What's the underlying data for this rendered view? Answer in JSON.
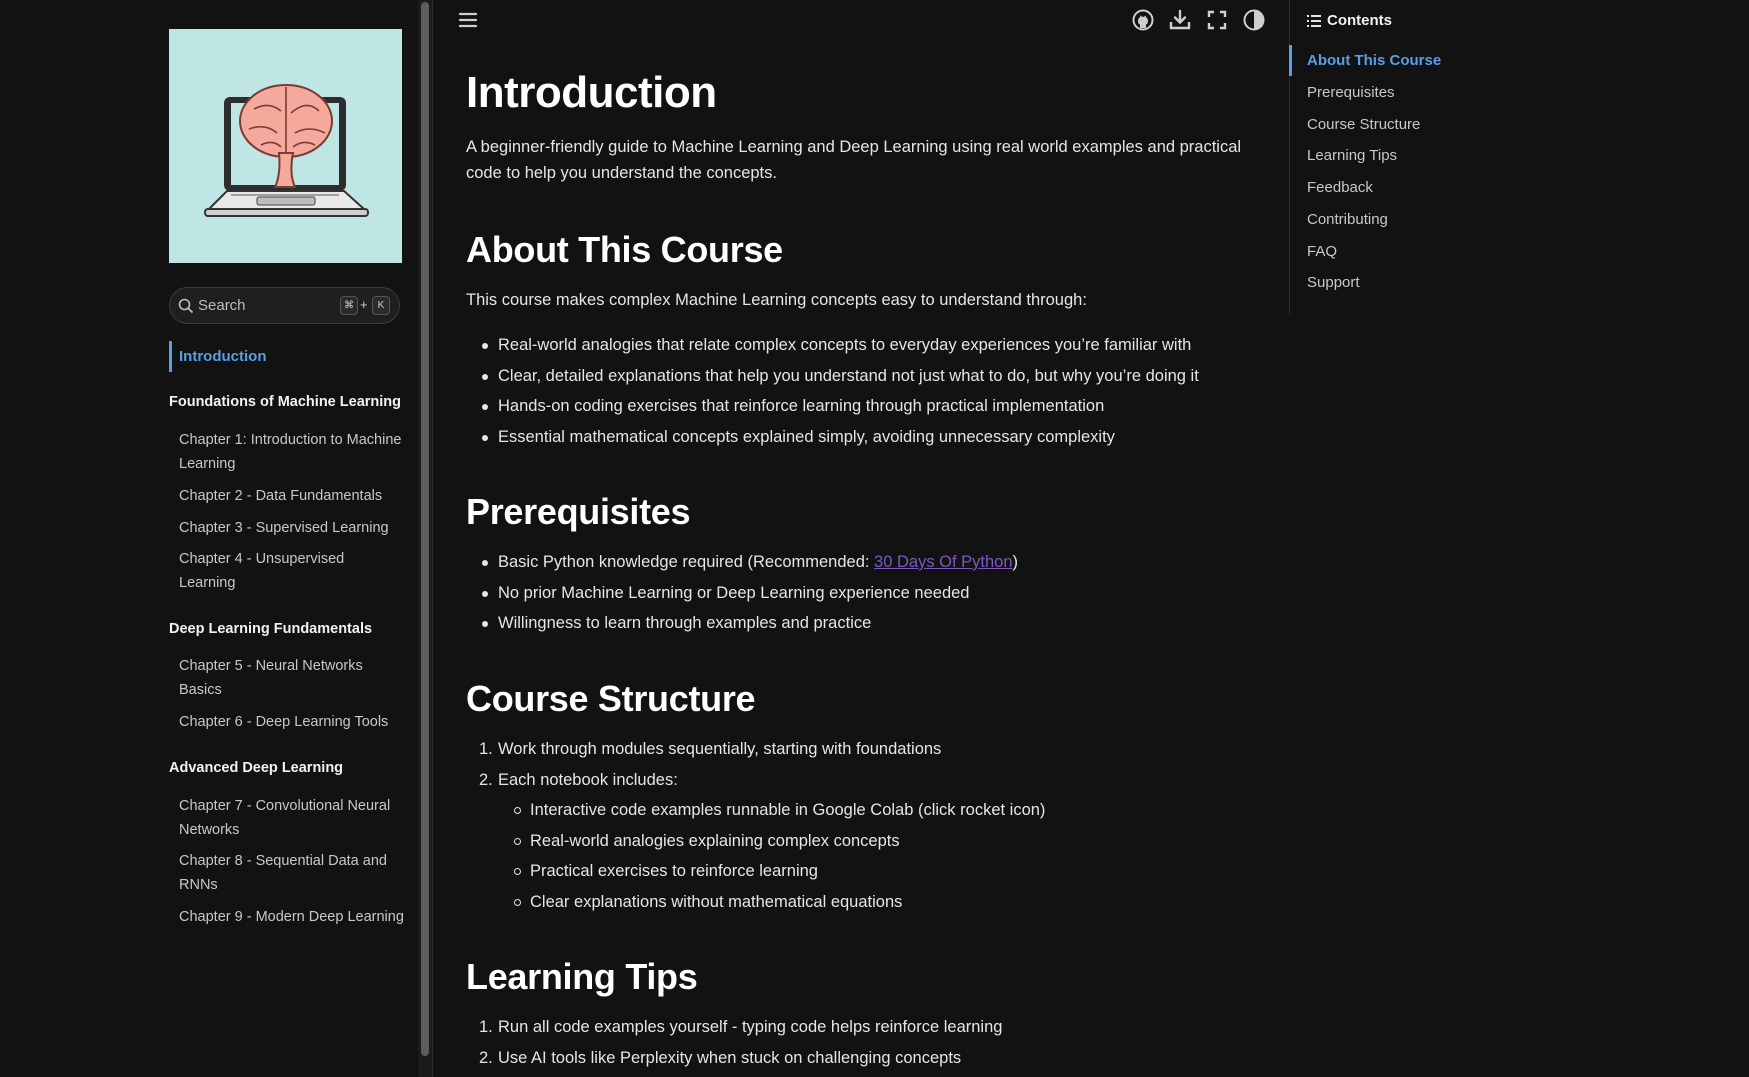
{
  "sidebar": {
    "search": {
      "placeholder": "Search",
      "shortcut_key1": "⌘",
      "shortcut_plus": "+",
      "shortcut_key2": "K"
    },
    "active_item": "Introduction",
    "sections": [
      {
        "title": "Foundations of Machine Learning",
        "items": [
          "Chapter 1: Introduction to Machine Learning",
          "Chapter 2 - Data Fundamentals",
          "Chapter 3 - Supervised Learning",
          "Chapter 4 - Unsupervised Learning"
        ]
      },
      {
        "title": "Deep Learning Fundamentals",
        "items": [
          "Chapter 5 - Neural Networks Basics",
          "Chapter 6 - Deep Learning Tools"
        ]
      },
      {
        "title": "Advanced Deep Learning",
        "items": [
          "Chapter 7 - Convolutional Neural Networks",
          "Chapter 8 - Sequential Data and RNNs",
          "Chapter 9 - Modern Deep Learning"
        ]
      }
    ]
  },
  "toolbar": {
    "icons": [
      "menu-icon",
      "github-icon",
      "download-icon",
      "fullscreen-icon",
      "theme-toggle-icon"
    ]
  },
  "article": {
    "title": "Introduction",
    "intro": "A beginner-friendly guide to Machine Learning and Deep Learning using real world examples and practical code to help you understand the concepts.",
    "about": {
      "heading": "About This Course",
      "lead": "This course makes complex Machine Learning concepts easy to understand through:",
      "bullets": [
        "Real-world analogies that relate complex concepts to everyday experiences you’re familiar with",
        "Clear, detailed explanations that help you understand not just what to do, but why you’re doing it",
        "Hands-on coding exercises that reinforce learning through practical implementation",
        "Essential mathematical concepts explained simply, avoiding unnecessary complexity"
      ]
    },
    "prereq": {
      "heading": "Prerequisites",
      "b1_prefix": "Basic Python knowledge required (Recommended: ",
      "b1_link": "30 Days Of Python",
      "b1_suffix": ")",
      "bullets": [
        "No prior Machine Learning or Deep Learning experience needed",
        "Willingness to learn through examples and practice"
      ]
    },
    "structure": {
      "heading": "Course Structure",
      "items": [
        "Work through modules sequentially, starting with foundations",
        "Each notebook includes:"
      ],
      "subitems": [
        "Interactive code examples runnable in Google Colab (click rocket icon)",
        "Real-world analogies explaining complex concepts",
        "Practical exercises to reinforce learning",
        "Clear explanations without mathematical equations"
      ]
    },
    "tips": {
      "heading": "Learning Tips",
      "items": [
        "Run all code examples yourself - typing code helps reinforce learning",
        "Use AI tools like Perplexity when stuck on challenging concepts"
      ]
    }
  },
  "toc": {
    "title": "Contents",
    "items": [
      "About This Course",
      "Prerequisites",
      "Course Structure",
      "Learning Tips",
      "Feedback",
      "Contributing",
      "FAQ",
      "Support"
    ]
  },
  "colors": {
    "accent": "#5a9ee8",
    "link": "#7e57c2",
    "background": "#121212"
  }
}
